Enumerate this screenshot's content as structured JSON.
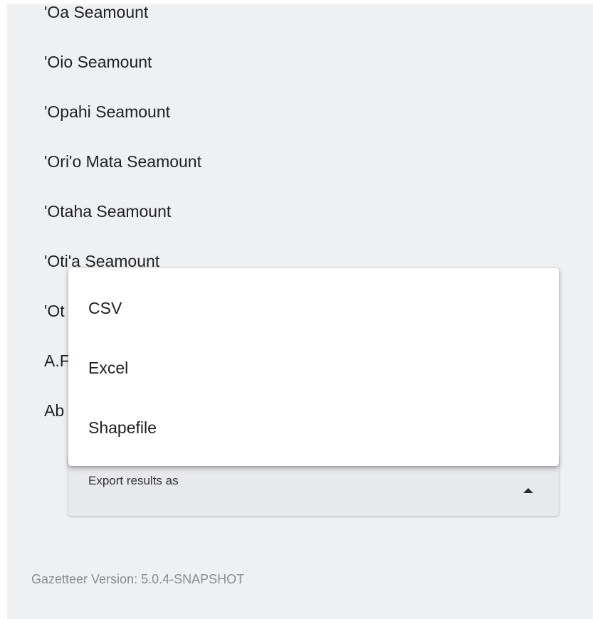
{
  "results": {
    "items": [
      "'Oa Seamount",
      "'Oio Seamount",
      "'Opahi Seamount",
      "'Ori'o Mata Seamount",
      "'Otaha Seamount",
      "'Oti'a Seamount",
      "'Ot",
      "A.F",
      "Ab"
    ]
  },
  "export": {
    "label": "Export results as",
    "options": [
      "CSV",
      "Excel",
      "Shapefile"
    ]
  },
  "footer": {
    "version": "Gazetteer Version: 5.0.4-SNAPSHOT"
  }
}
